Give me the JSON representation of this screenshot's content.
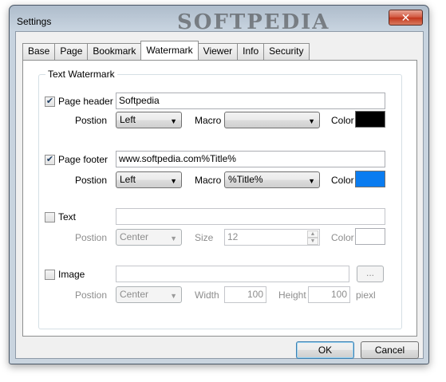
{
  "window": {
    "title": "Settings",
    "watermark": "SOFTPEDIA",
    "close_glyph": "✕"
  },
  "tabs": [
    {
      "label": "Base"
    },
    {
      "label": "Page"
    },
    {
      "label": "Bookmark"
    },
    {
      "label": "Watermark"
    },
    {
      "label": "Viewer"
    },
    {
      "label": "Info"
    },
    {
      "label": "Security"
    }
  ],
  "group": {
    "title": "Text Watermark"
  },
  "page_header": {
    "label": "Page header",
    "checked": true,
    "text": "Softpedia",
    "position_label": "Postion",
    "position": "Left",
    "macro_label": "Macro",
    "macro": "",
    "color_label": "Color",
    "color": "#000000"
  },
  "page_footer": {
    "label": "Page footer",
    "checked": true,
    "text": "www.softpedia.com%Title%",
    "position_label": "Postion",
    "position": "Left",
    "macro_label": "Macro",
    "macro": "%Title%",
    "color_label": "Color",
    "color": "#0a7cf0"
  },
  "text_wm": {
    "label": "Text",
    "checked": false,
    "text": "",
    "position_label": "Postion",
    "position": "Center",
    "size_label": "Size",
    "size": "12",
    "color_label": "Color",
    "color": "#ffffff"
  },
  "image_wm": {
    "label": "Image",
    "checked": false,
    "path": "",
    "browse_label": "...",
    "position_label": "Postion",
    "position": "Center",
    "width_label": "Width",
    "width": "100",
    "height_label": "Height",
    "height": "100",
    "unit": "piexl"
  },
  "icons": {
    "check": "✔",
    "dropdown": "▼",
    "spin_up": "▲",
    "spin_down": "▼"
  },
  "buttons": {
    "ok": "OK",
    "cancel": "Cancel"
  }
}
